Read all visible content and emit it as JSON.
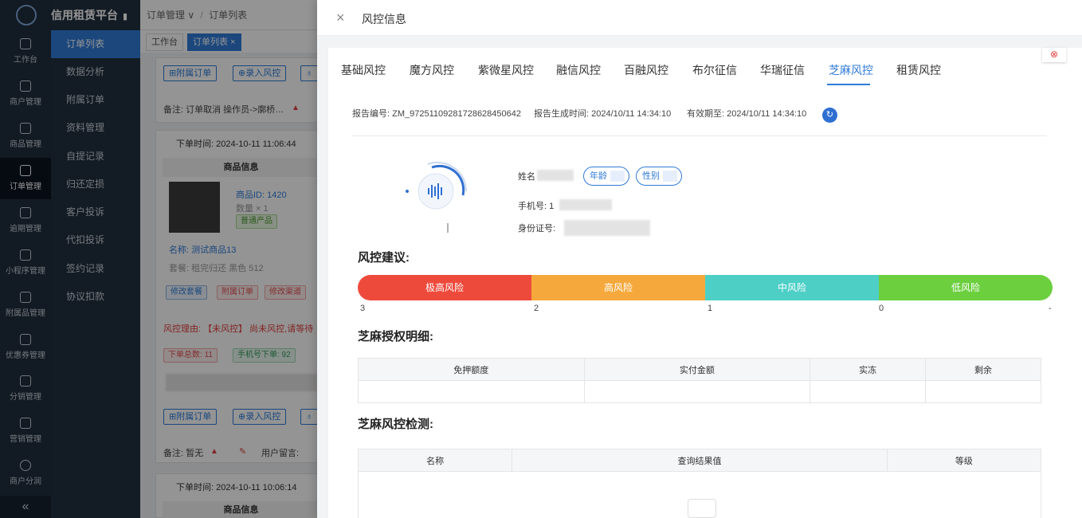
{
  "app": {
    "brand": "信用租赁平台",
    "pin_icon": "pin-icon"
  },
  "left_nav": [
    {
      "label": "工作台",
      "icon": "home-icon"
    },
    {
      "label": "商户管理",
      "icon": "shop-icon"
    },
    {
      "label": "商品管理",
      "icon": "apple-icon"
    },
    {
      "label": "订单管理",
      "icon": "trophy-icon",
      "active": true
    },
    {
      "label": "逾期管理",
      "icon": "alarm-icon"
    },
    {
      "label": "小程序管理",
      "icon": "watch-icon"
    },
    {
      "label": "附属品管理",
      "icon": "cart-icon"
    },
    {
      "label": "优惠券管理",
      "icon": "gift-icon"
    },
    {
      "label": "分销管理",
      "icon": "chart-icon"
    },
    {
      "label": "营销管理",
      "icon": "megaphone-icon"
    },
    {
      "label": "商户分润",
      "icon": "coin-icon"
    }
  ],
  "nav_collapse": "«",
  "sub_nav": [
    "订单列表",
    "数据分析",
    "附属订单",
    "资料管理",
    "自提记录",
    "归还定损",
    "客户投诉",
    "代扣投诉",
    "签约记录",
    "协议扣款"
  ],
  "breadcrumb": {
    "section": "订单管理 ∨",
    "sep": "/",
    "page": "订单列表"
  },
  "page_tabs": {
    "home": "工作台",
    "current": "订单列表",
    "close": "×"
  },
  "order_panel": {
    "btn_attach": "附属订单",
    "btn_risk": "录入风控",
    "btn_more": "♁",
    "remark1": "备注: 订单取消 操作员->廓桥…",
    "order_time1": "下单时间: 2024-10-11 11:06:44",
    "goods_header": "商品信息",
    "goods_id": "商品ID: 1420",
    "qty": "数量 × 1",
    "tag_normal": "普通产品",
    "goods_name": "名称: 测试商品13",
    "package": "套餐: 租完归还 黑色 512",
    "btn_edit_pkg": "修改套餐",
    "btn_attach_order": "附属订单",
    "btn_edit_channel": "修改渠道",
    "risk_reason": "风控理由: 【未风控】 尚未风控,请等待",
    "tag_total": "下单总数: 11",
    "tag_phone": "手机号下单: 92",
    "remark2": "备注: 暂无",
    "user_msg": "用户留言:",
    "order_time2": "下单时间: 2024-10-11 10:06:14",
    "goods_header2": "商品信息"
  },
  "drawer": {
    "close": "×",
    "title": "风控信息",
    "tabs": [
      "基础风控",
      "魔方风控",
      "紫微星风控",
      "融信风控",
      "百融风控",
      "布尔征信",
      "华瑞征信",
      "芝麻风控",
      "租赁风控"
    ],
    "active_tab": "芝麻风控",
    "close_icon": "⊗",
    "report_no": "报告编号: ZM_97251109281728628450642",
    "report_time": "报告生成时间: 2024/10/11 14:34:10",
    "valid_until": "有效期至: 2024/10/11 14:34:10",
    "refresh_icon": "↻",
    "name_label": "姓名",
    "age_label": "年龄",
    "gender_label": "性别",
    "phone_label": "手机号: 1",
    "id_label": "身份证号:",
    "advice_title": "风控建议:",
    "levels": [
      {
        "label": "极高风险",
        "color": "#ee4a3c",
        "score": "3"
      },
      {
        "label": "高风险",
        "color": "#f5a93d",
        "score": "2"
      },
      {
        "label": "中风险",
        "color": "#4dcfc6",
        "score": "1"
      },
      {
        "label": "低风险",
        "color": "#6bcf3e",
        "score": "0"
      }
    ],
    "scale_end": "-",
    "auth_title": "芝麻授权明细:",
    "auth_cols": [
      "免押额度",
      "实付金额",
      "实冻",
      "剩余"
    ],
    "detect_title": "芝麻风控检测:",
    "detect_cols": [
      "名称",
      "查询结果值",
      "等级"
    ]
  }
}
